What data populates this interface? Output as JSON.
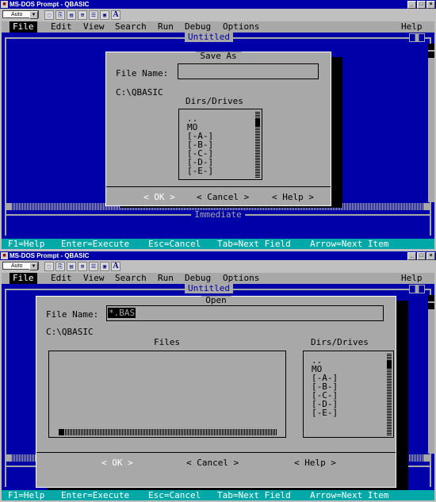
{
  "window_title": "MS-DOS Prompt - QBASIC",
  "titlebar_buttons": [
    "_",
    "□",
    "×"
  ],
  "toolbar": {
    "font_select": "Auto",
    "font_icon_label": "A"
  },
  "qbasic": {
    "menu": {
      "file": "File",
      "edit": "Edit",
      "view": "View",
      "search": "Search",
      "run": "Run",
      "debug": "Debug",
      "options": "Options",
      "help": "Help"
    },
    "editor_title": "Untitled",
    "immediate_title": "Immediate",
    "status": {
      "help": "F1=Help",
      "execute": "Enter=Execute",
      "cancel": "Esc=Cancel",
      "next_field": "Tab=Next Field",
      "next_item": "Arrow=Next Item"
    }
  },
  "save_as_dialog": {
    "title": "Save As",
    "file_name_label": "File Name:",
    "file_name_value": "",
    "current_dir": "C:\\QBASIC",
    "dirs_label": "Dirs/Drives",
    "dirs": [
      "..",
      "MO",
      "[-A-]",
      "[-B-]",
      "[-C-]",
      "[-D-]",
      "[-E-]"
    ],
    "ok": "< OK >",
    "cancel": "< Cancel >",
    "help": "< Help >"
  },
  "open_dialog": {
    "title": "Open",
    "file_name_label": "File Name:",
    "file_name_value": "*.BAS",
    "current_dir": "C:\\QBASIC",
    "files_label": "Files",
    "files": [],
    "dirs_label": "Dirs/Drives",
    "dirs": [
      "..",
      "MO",
      "[-A-]",
      "[-B-]",
      "[-C-]",
      "[-D-]",
      "[-E-]"
    ],
    "ok": "< OK >",
    "cancel": "< Cancel >",
    "help": "< Help >"
  }
}
